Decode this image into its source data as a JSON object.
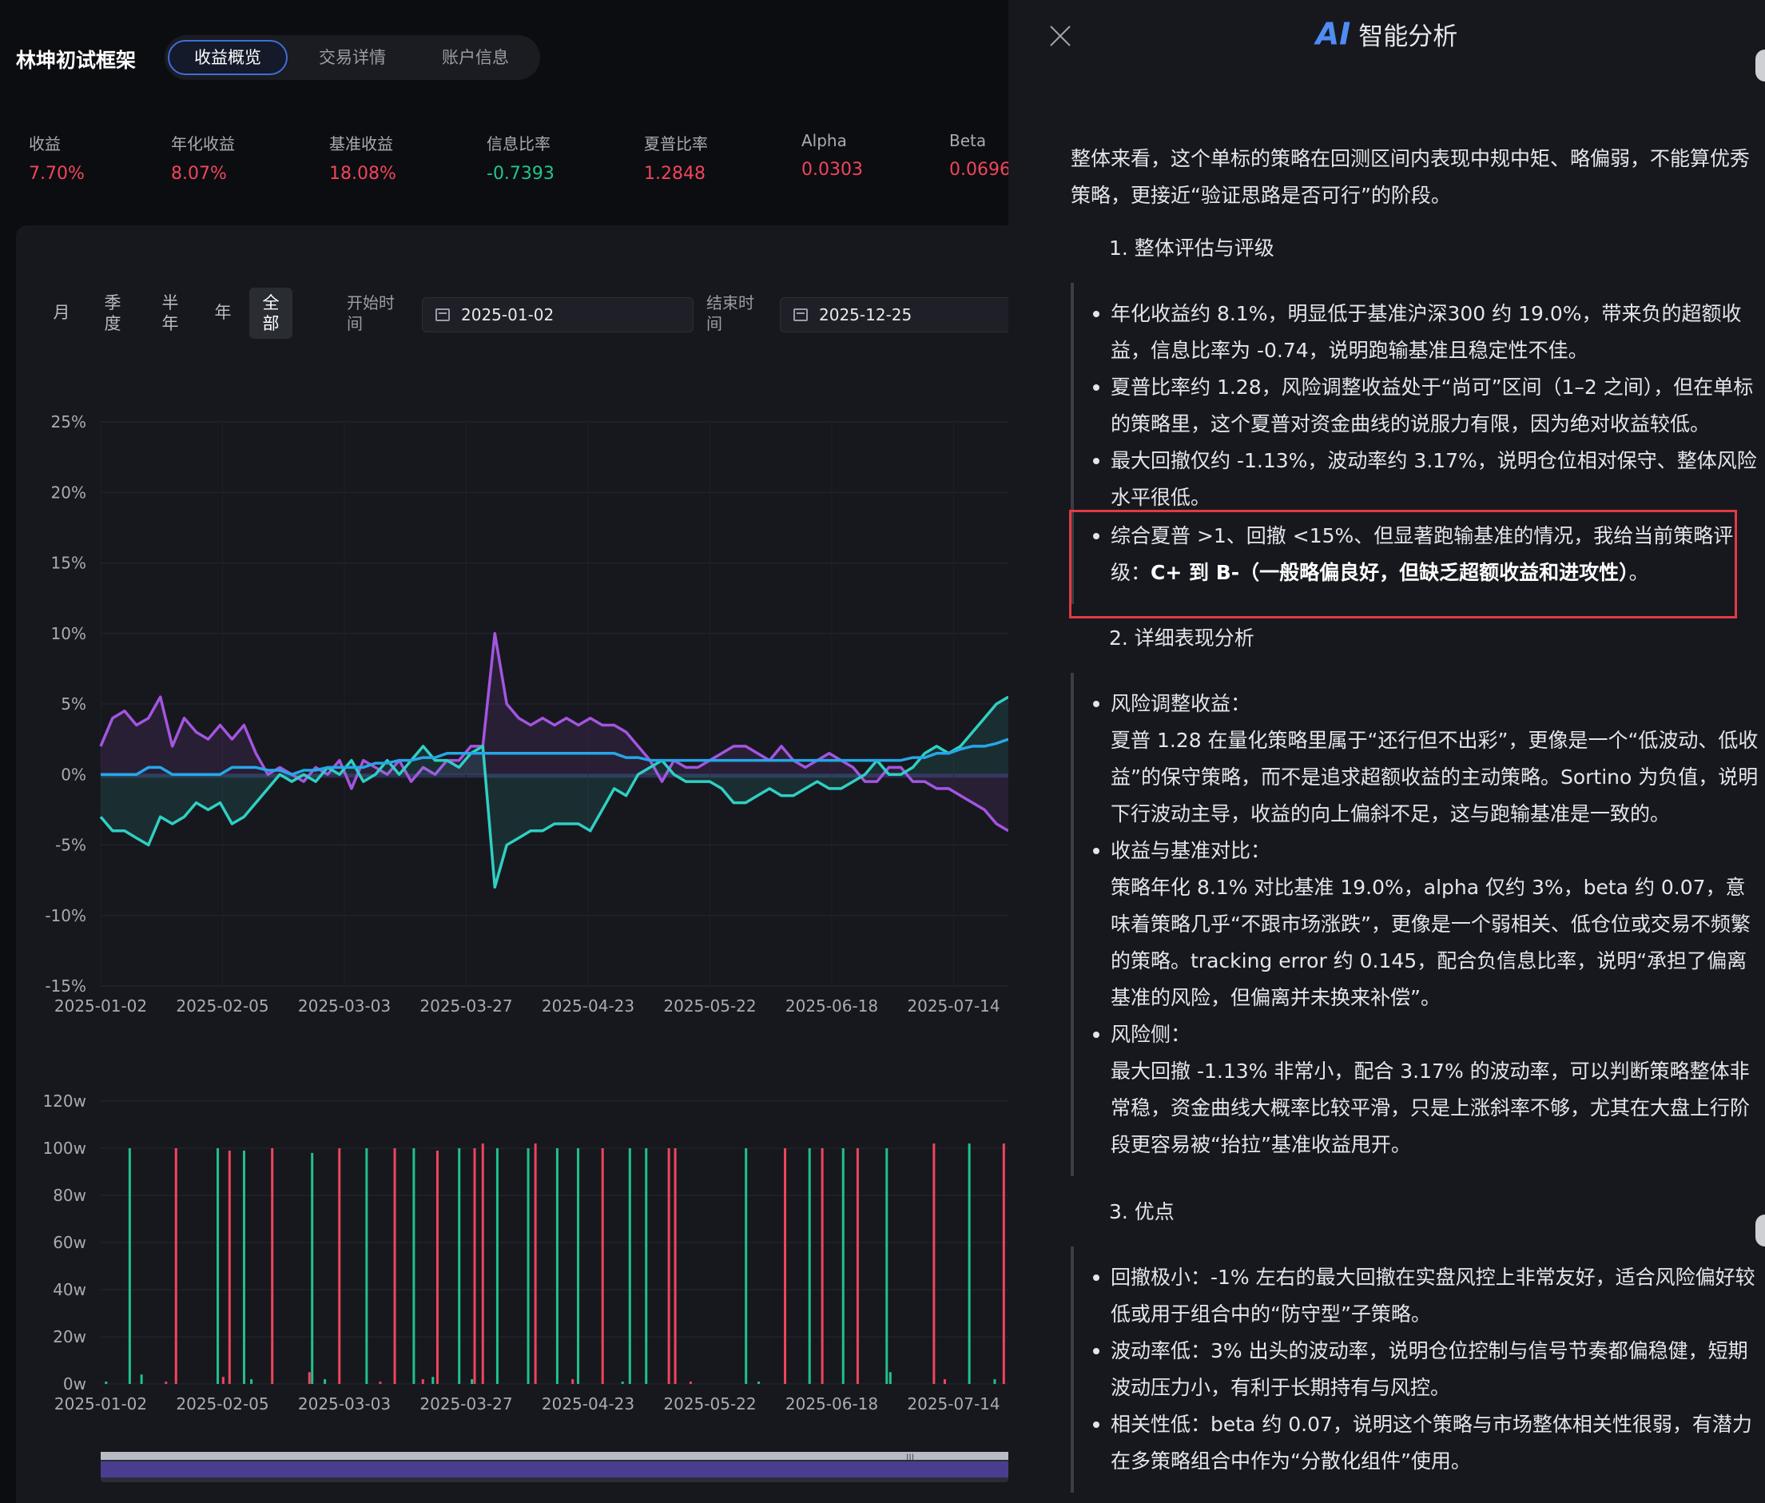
{
  "app": {
    "title": "林坤初试框架"
  },
  "tabs": [
    {
      "label": "收益概览",
      "active": true
    },
    {
      "label": "交易详情",
      "active": false
    },
    {
      "label": "账户信息",
      "active": false
    }
  ],
  "metrics": [
    {
      "label": "收益",
      "value": "7.70%",
      "color": "#f0455b"
    },
    {
      "label": "年化收益",
      "value": "8.07%",
      "color": "#f0455b"
    },
    {
      "label": "基准收益",
      "value": "18.08%",
      "color": "#f0455b"
    },
    {
      "label": "信息比率",
      "value": "-0.7393",
      "color": "#22c58a"
    },
    {
      "label": "夏普比率",
      "value": "1.2848",
      "color": "#f0455b"
    },
    {
      "label": "Alpha",
      "value": "0.0303",
      "color": "#f0455b"
    },
    {
      "label": "Beta",
      "value": "0.0696",
      "color": "#f0455b"
    }
  ],
  "periods": [
    "月",
    "季度",
    "半年",
    "年",
    "全部"
  ],
  "period_active": "全部",
  "date_range": {
    "start_label": "开始时间",
    "start_value": "2025-01-02",
    "end_label": "结束时间",
    "end_value": "2025-12-25"
  },
  "chart_data": [
    {
      "type": "line",
      "ylim": [
        -15,
        25
      ],
      "y_ticks": [
        "25%",
        "20%",
        "15%",
        "10%",
        "5%",
        "0%",
        "-5%",
        "-10%",
        "-15%"
      ],
      "x_ticks": [
        "2025-01-02",
        "2025-02-05",
        "2025-03-03",
        "2025-03-27",
        "2025-04-23",
        "2025-05-22",
        "2025-06-18",
        "2025-07-14"
      ],
      "colors": {
        "purple": "#a455e0",
        "teal": "#2fd0c2",
        "blue": "#26a7e8"
      },
      "series": [
        {
          "color": "#a455e0",
          "values": [
            2,
            4,
            4.5,
            3.5,
            4,
            5.5,
            2,
            4,
            3,
            2.5,
            3.5,
            2.5,
            3.5,
            1.5,
            0,
            0.5,
            0,
            -0.5,
            0.5,
            0,
            1,
            -1,
            1,
            0.5,
            0,
            1,
            -0.5,
            0.5,
            0,
            1,
            1,
            2,
            2,
            10,
            5,
            4,
            3.5,
            4,
            3.5,
            4,
            3.5,
            4,
            3.5,
            3.5,
            3,
            2,
            1,
            -0.5,
            1,
            0.5,
            0.5,
            1,
            1.5,
            2,
            2,
            1.5,
            1,
            2,
            1,
            0.5,
            1,
            1.5,
            1,
            0.5,
            -0.5,
            -0.5,
            0.5,
            0.5,
            -0.5,
            -0.5,
            -1,
            -1,
            -1.5,
            -2,
            -2.5,
            -3.5,
            -4
          ]
        },
        {
          "color": "#2fd0c2",
          "values": [
            -3,
            -4,
            -4,
            -4.5,
            -5,
            -3,
            -3.5,
            -3,
            -2,
            -2.5,
            -2,
            -3.5,
            -3,
            -2,
            -1,
            0,
            -0.5,
            0,
            -0.5,
            0.5,
            0,
            1,
            -0.5,
            0,
            1,
            0,
            1,
            2,
            1,
            1,
            0.5,
            1.5,
            2,
            -8,
            -5,
            -4.5,
            -4,
            -4,
            -3.5,
            -3.5,
            -3.5,
            -4,
            -2.5,
            -1,
            -1.5,
            0,
            0.5,
            1,
            0,
            -0.5,
            -0.5,
            -0.5,
            -1,
            -2,
            -2,
            -1.5,
            -1,
            -1.5,
            -1.5,
            -1,
            -0.5,
            -1,
            -1,
            -0.5,
            0,
            1,
            0,
            0,
            0.5,
            1.5,
            2,
            1.5,
            2,
            3,
            4,
            5,
            5.5
          ]
        },
        {
          "color": "#26a7e8",
          "values": [
            0,
            0,
            0,
            0,
            0.5,
            0.5,
            0,
            0,
            0,
            0,
            0,
            0.5,
            0.5,
            0.5,
            0.3,
            0.3,
            0,
            0.3,
            0.3,
            0.5,
            0.5,
            0.5,
            0.5,
            0.8,
            0.8,
            1,
            1,
            1.2,
            1.2,
            1.5,
            1.5,
            1.5,
            1.5,
            1.5,
            1.5,
            1.5,
            1.5,
            1.5,
            1.5,
            1.5,
            1.5,
            1.5,
            1.5,
            1.5,
            1.2,
            1.2,
            1,
            1,
            1,
            1,
            1,
            1,
            1,
            1,
            1,
            1,
            1,
            1,
            1,
            1,
            1,
            1,
            1,
            1,
            1,
            1,
            1,
            1,
            1.2,
            1.2,
            1.5,
            1.5,
            1.8,
            2,
            2,
            2.2,
            2.5
          ]
        }
      ]
    },
    {
      "type": "bar",
      "ylim": [
        0,
        120
      ],
      "y_ticks": [
        "120w",
        "100w",
        "80w",
        "60w",
        "40w",
        "20w",
        "0w"
      ],
      "x_ticks": [
        "2025-01-02",
        "2025-02-05",
        "2025-03-03",
        "2025-03-27",
        "2025-04-23",
        "2025-05-22",
        "2025-06-18",
        "2025-07-14"
      ],
      "colors": {
        "buy": "#1fc28b",
        "sell": "#f0455b"
      },
      "bars": [
        {
          "x": 0.032,
          "v": 100,
          "s": "buy"
        },
        {
          "x": 0.083,
          "v": 100,
          "s": "sell"
        },
        {
          "x": 0.129,
          "v": 100,
          "s": "buy"
        },
        {
          "x": 0.142,
          "v": 99,
          "s": "sell"
        },
        {
          "x": 0.158,
          "v": 99,
          "s": "buy"
        },
        {
          "x": 0.189,
          "v": 100,
          "s": "sell"
        },
        {
          "x": 0.233,
          "v": 98,
          "s": "buy"
        },
        {
          "x": 0.263,
          "v": 100,
          "s": "sell"
        },
        {
          "x": 0.293,
          "v": 100,
          "s": "buy"
        },
        {
          "x": 0.324,
          "v": 100,
          "s": "sell"
        },
        {
          "x": 0.345,
          "v": 100,
          "s": "buy"
        },
        {
          "x": 0.371,
          "v": 99,
          "s": "sell"
        },
        {
          "x": 0.395,
          "v": 100,
          "s": "buy"
        },
        {
          "x": 0.412,
          "v": 100,
          "s": "sell"
        },
        {
          "x": 0.421,
          "v": 102,
          "s": "sell"
        },
        {
          "x": 0.437,
          "v": 100,
          "s": "buy"
        },
        {
          "x": 0.471,
          "v": 100,
          "s": "buy"
        },
        {
          "x": 0.479,
          "v": 102,
          "s": "sell"
        },
        {
          "x": 0.503,
          "v": 100,
          "s": "buy"
        },
        {
          "x": 0.526,
          "v": 100,
          "s": "buy"
        },
        {
          "x": 0.553,
          "v": 100,
          "s": "sell"
        },
        {
          "x": 0.583,
          "v": 100,
          "s": "buy"
        },
        {
          "x": 0.601,
          "v": 100,
          "s": "buy"
        },
        {
          "x": 0.626,
          "v": 100,
          "s": "sell"
        },
        {
          "x": 0.633,
          "v": 100,
          "s": "sell"
        },
        {
          "x": 0.711,
          "v": 100,
          "s": "buy"
        },
        {
          "x": 0.754,
          "v": 100,
          "s": "sell"
        },
        {
          "x": 0.781,
          "v": 100,
          "s": "buy"
        },
        {
          "x": 0.795,
          "v": 100,
          "s": "sell"
        },
        {
          "x": 0.818,
          "v": 100,
          "s": "buy"
        },
        {
          "x": 0.834,
          "v": 100,
          "s": "sell"
        },
        {
          "x": 0.866,
          "v": 100,
          "s": "buy"
        },
        {
          "x": 0.918,
          "v": 102,
          "s": "sell"
        },
        {
          "x": 0.957,
          "v": 102,
          "s": "buy"
        },
        {
          "x": 0.995,
          "v": 102,
          "s": "sell"
        },
        {
          "x": 0.006,
          "v": 1,
          "s": "buy"
        },
        {
          "x": 0.045,
          "v": 4,
          "s": "buy"
        },
        {
          "x": 0.072,
          "v": 1,
          "s": "sell"
        },
        {
          "x": 0.135,
          "v": 3,
          "s": "sell"
        },
        {
          "x": 0.166,
          "v": 2,
          "s": "buy"
        },
        {
          "x": 0.23,
          "v": 5,
          "s": "sell"
        },
        {
          "x": 0.247,
          "v": 2,
          "s": "buy"
        },
        {
          "x": 0.308,
          "v": 1,
          "s": "sell"
        },
        {
          "x": 0.355,
          "v": 2,
          "s": "sell"
        },
        {
          "x": 0.366,
          "v": 3,
          "s": "buy"
        },
        {
          "x": 0.409,
          "v": 2,
          "s": "buy"
        },
        {
          "x": 0.52,
          "v": 2,
          "s": "sell"
        },
        {
          "x": 0.575,
          "v": 1,
          "s": "buy"
        },
        {
          "x": 0.65,
          "v": 1,
          "s": "sell"
        },
        {
          "x": 0.725,
          "v": 1,
          "s": "buy"
        },
        {
          "x": 0.87,
          "v": 5,
          "s": "buy"
        },
        {
          "x": 0.93,
          "v": 2,
          "s": "sell"
        },
        {
          "x": 0.985,
          "v": 2,
          "s": "buy"
        }
      ]
    }
  ],
  "ai_panel": {
    "logo": "AI",
    "title": "智能分析",
    "intro": "整体来看，这个单标的策略在回测区间内表现中规中矩、略偏弱，不能算优秀策略，更接近“验证思路是否可行”的阶段。",
    "sections": [
      {
        "heading": "1. 整体评估与评级",
        "bullets": [
          {
            "text": "年化收益约 8.1%，明显低于基准沪深300 约 19.0%，带来负的超额收益，信息比率为 -0.74，说明跑输基准且稳定性不佳。"
          },
          {
            "text": "夏普比率约 1.28，风险调整收益处于“尚可”区间（1–2 之间），但在单标的策略里，这个夏普对资金曲线的说服力有限，因为绝对收益较低。"
          },
          {
            "text": "最大回撤仅约 -1.13%，波动率约 3.17%，说明仓位相对保守、整体风险水平很低。"
          },
          {
            "text": "综合夏普 >1、回撤 <15%、但显著跑输基准的情况，我给当前策略评级：",
            "strong": "C+ 到 B-（一般略偏良好，但缺乏超额收益和进攻性）",
            "tail": "。"
          }
        ]
      },
      {
        "heading": "2. 详细表现分析",
        "bullets": [
          {
            "title": "风险调整收益：",
            "text": "夏普 1.28 在量化策略里属于“还行但不出彩”，更像是一个“低波动、低收益”的保守策略，而不是追求超额收益的主动策略。Sortino 为负值，说明下行波动主导，收益的向上偏斜不足，这与跑输基准是一致的。"
          },
          {
            "title": "收益与基准对比：",
            "text": "策略年化 8.1% 对比基准 19.0%，alpha 仅约 3%，beta 约 0.07，意味着策略几乎“不跟市场涨跌”，更像是一个弱相关、低仓位或交易不频繁的策略。tracking error 约 0.145，配合负信息比率，说明“承担了偏离基准的风险，但偏离并未换来补偿”。"
          },
          {
            "title": "风险侧：",
            "text": "最大回撤 -1.13% 非常小，配合 3.17% 的波动率，可以判断策略整体非常稳，资金曲线大概率比较平滑，只是上涨斜率不够，尤其在大盘上行阶段更容易被“抬拉”基准收益甩开。"
          }
        ]
      },
      {
        "heading": "3. 优点",
        "bullets": [
          {
            "text": "回撤极小：-1% 左右的最大回撤在实盘风控上非常友好，适合风险偏好较低或用于组合中的“防守型”子策略。"
          },
          {
            "text": "波动率低：3% 出头的波动率，说明仓位控制与信号节奏都偏稳健，短期波动压力小，有利于长期持有与风控。"
          },
          {
            "text": "相关性低：beta 约 0.07，说明这个策略与市场整体相关性很弱，有潜力在多策略组合中作为“分散化组件”使用。"
          }
        ]
      }
    ]
  }
}
